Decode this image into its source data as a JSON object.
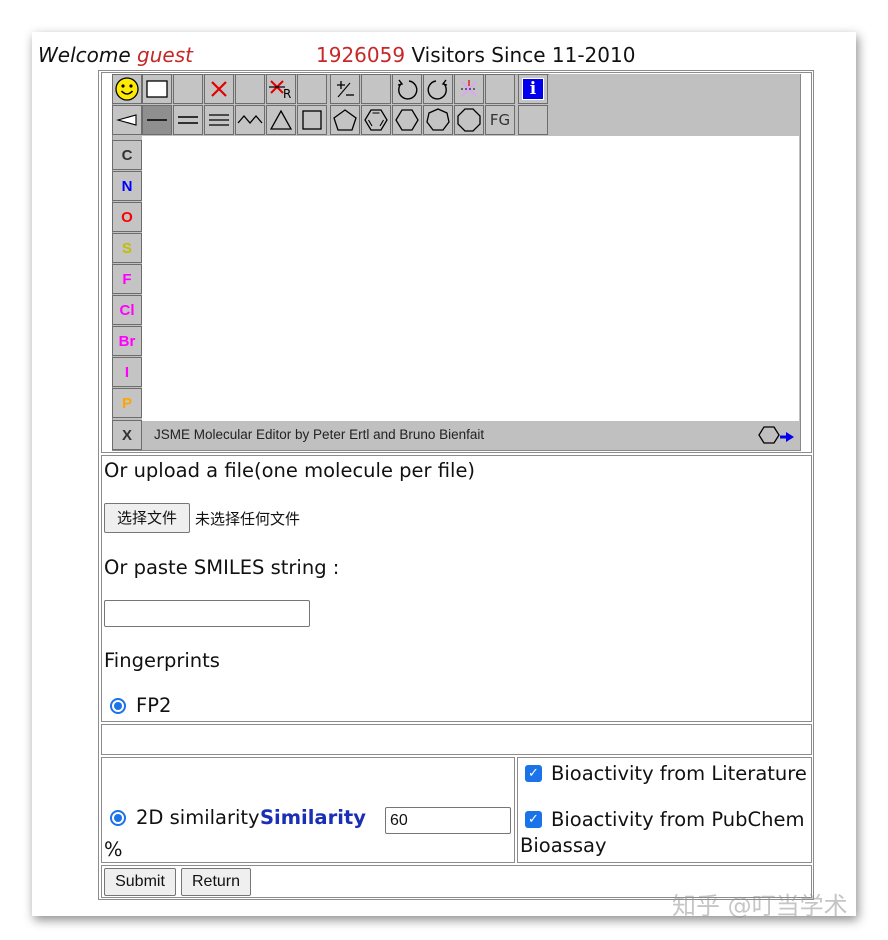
{
  "header": {
    "welcome_label": "Welcome",
    "user": "guest",
    "visitor_count": "1926059",
    "visitors_suffix": "Visitors Since 11-2010"
  },
  "jsme": {
    "toolbar_row1_icons": [
      "smiley-icon",
      "rectangle-select-icon",
      "blank",
      "delete-x-icon",
      "blank",
      "delete-r-group-icon",
      "blank",
      "charge-plus-minus-icon",
      "blank",
      "undo-icon",
      "redo-icon",
      "clear-icon",
      "blank",
      "info-icon"
    ],
    "toolbar_row2_icons": [
      "wedge-bond-icon",
      "single-bond-icon",
      "double-bond-icon",
      "triple-bond-icon",
      "chain-icon",
      "triangle-ring-icon",
      "square-ring-icon",
      "pentagon-ring-icon",
      "benzene-ring-icon",
      "hexagon-ring-icon",
      "heptagon-ring-icon",
      "octagon-ring-icon",
      "functional-group-icon"
    ],
    "fg_label": "FG",
    "info_label": "i",
    "elements": [
      {
        "symbol": "C",
        "color": "#333333"
      },
      {
        "symbol": "N",
        "color": "#0000ff"
      },
      {
        "symbol": "O",
        "color": "#ff0000"
      },
      {
        "symbol": "S",
        "color": "#bfbf00"
      },
      {
        "symbol": "F",
        "color": "#ff00ff"
      },
      {
        "symbol": "Cl",
        "color": "#ff00ff"
      },
      {
        "symbol": "Br",
        "color": "#ff00ff"
      },
      {
        "symbol": "I",
        "color": "#ff00ff"
      },
      {
        "symbol": "P",
        "color": "#ffa500"
      },
      {
        "symbol": "X",
        "color": "#333333"
      }
    ],
    "status_text": "JSME Molecular Editor by Peter Ertl and Bruno Bienfait"
  },
  "upload": {
    "heading": "Or upload a file(one molecule per file)",
    "choose_button": "选择文件",
    "no_file_text": "未选择任何文件"
  },
  "smiles": {
    "label": "Or paste SMILES string :",
    "value": ""
  },
  "fingerprints": {
    "label": "Fingerprints",
    "option": "FP2"
  },
  "search": {
    "option_label": "2D similarity",
    "similarity_label": "Similarity",
    "similarity_value": "60",
    "percent": "%"
  },
  "bioactivity": {
    "literature_label": "Bioactivity from Literature",
    "pubchem_label": "Bioactivity from PubChem",
    "pubchem_suffix": "Bioassay"
  },
  "actions": {
    "submit_label": "Submit",
    "return_label": "Return"
  },
  "watermark": "知乎 @叮当学术",
  "colors": {
    "accent": "#1a73e8",
    "highlight_red": "#c62828",
    "similarity_blue": "#1a2fb5"
  }
}
